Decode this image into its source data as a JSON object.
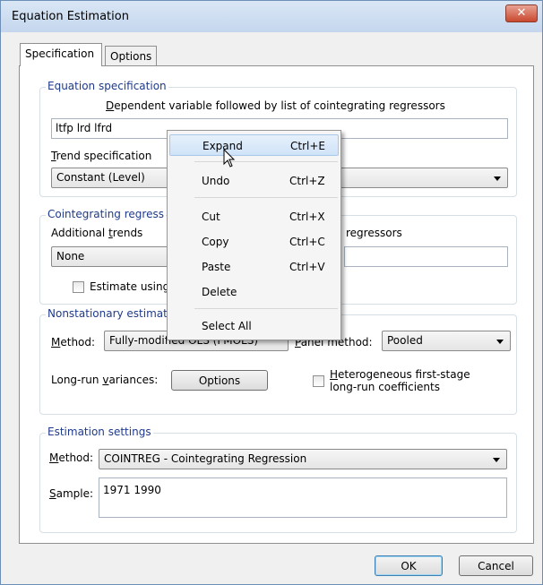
{
  "window": {
    "title": "Equation Estimation",
    "close_glyph": "✕"
  },
  "tabs": {
    "specification": "Specification",
    "options": "Options"
  },
  "equation_spec": {
    "group_title": "Equation specification",
    "dependent_label": "Dependent variable followed by list of cointegrating regressors",
    "equation_value": "ltfp lrd lfrd",
    "trend_label": "Trend specification",
    "trend_value": "Constant (Level)"
  },
  "cointegrating": {
    "group_title": "Cointegrating regress",
    "additional_trends_label": "Additional trends",
    "additional_trends_value": "None",
    "regressors_label": "regressors",
    "estimate_using_label": "Estimate using"
  },
  "nonstationary": {
    "group_title": "Nonstationary estimat",
    "method_label": "Method:",
    "method_value": "Fully-modified OLS (FMOLS)",
    "panel_method_label": "Panel method:",
    "panel_method_value": "Pooled",
    "longrun_label": "Long-run variances:",
    "options_button": "Options",
    "heterogeneous_label_1": "Heterogeneous first-stage",
    "heterogeneous_label_2": "long-run coefficients"
  },
  "estimation": {
    "group_title": "Estimation settings",
    "method_label": "Method:",
    "method_value": "COINTREG  -  Cointegrating Regression",
    "sample_label": "Sample:",
    "sample_value": "1971 1990"
  },
  "buttons": {
    "ok": "OK",
    "cancel": "Cancel"
  },
  "context_menu": {
    "expand": {
      "label": "Expand",
      "shortcut": "Ctrl+E"
    },
    "undo": {
      "label": "Undo",
      "shortcut": "Ctrl+Z"
    },
    "cut": {
      "label": "Cut",
      "shortcut": "Ctrl+X"
    },
    "copy": {
      "label": "Copy",
      "shortcut": "Ctrl+C"
    },
    "paste": {
      "label": "Paste",
      "shortcut": "Ctrl+V"
    },
    "delete": {
      "label": "Delete"
    },
    "select_all": {
      "label": "Select All"
    }
  }
}
